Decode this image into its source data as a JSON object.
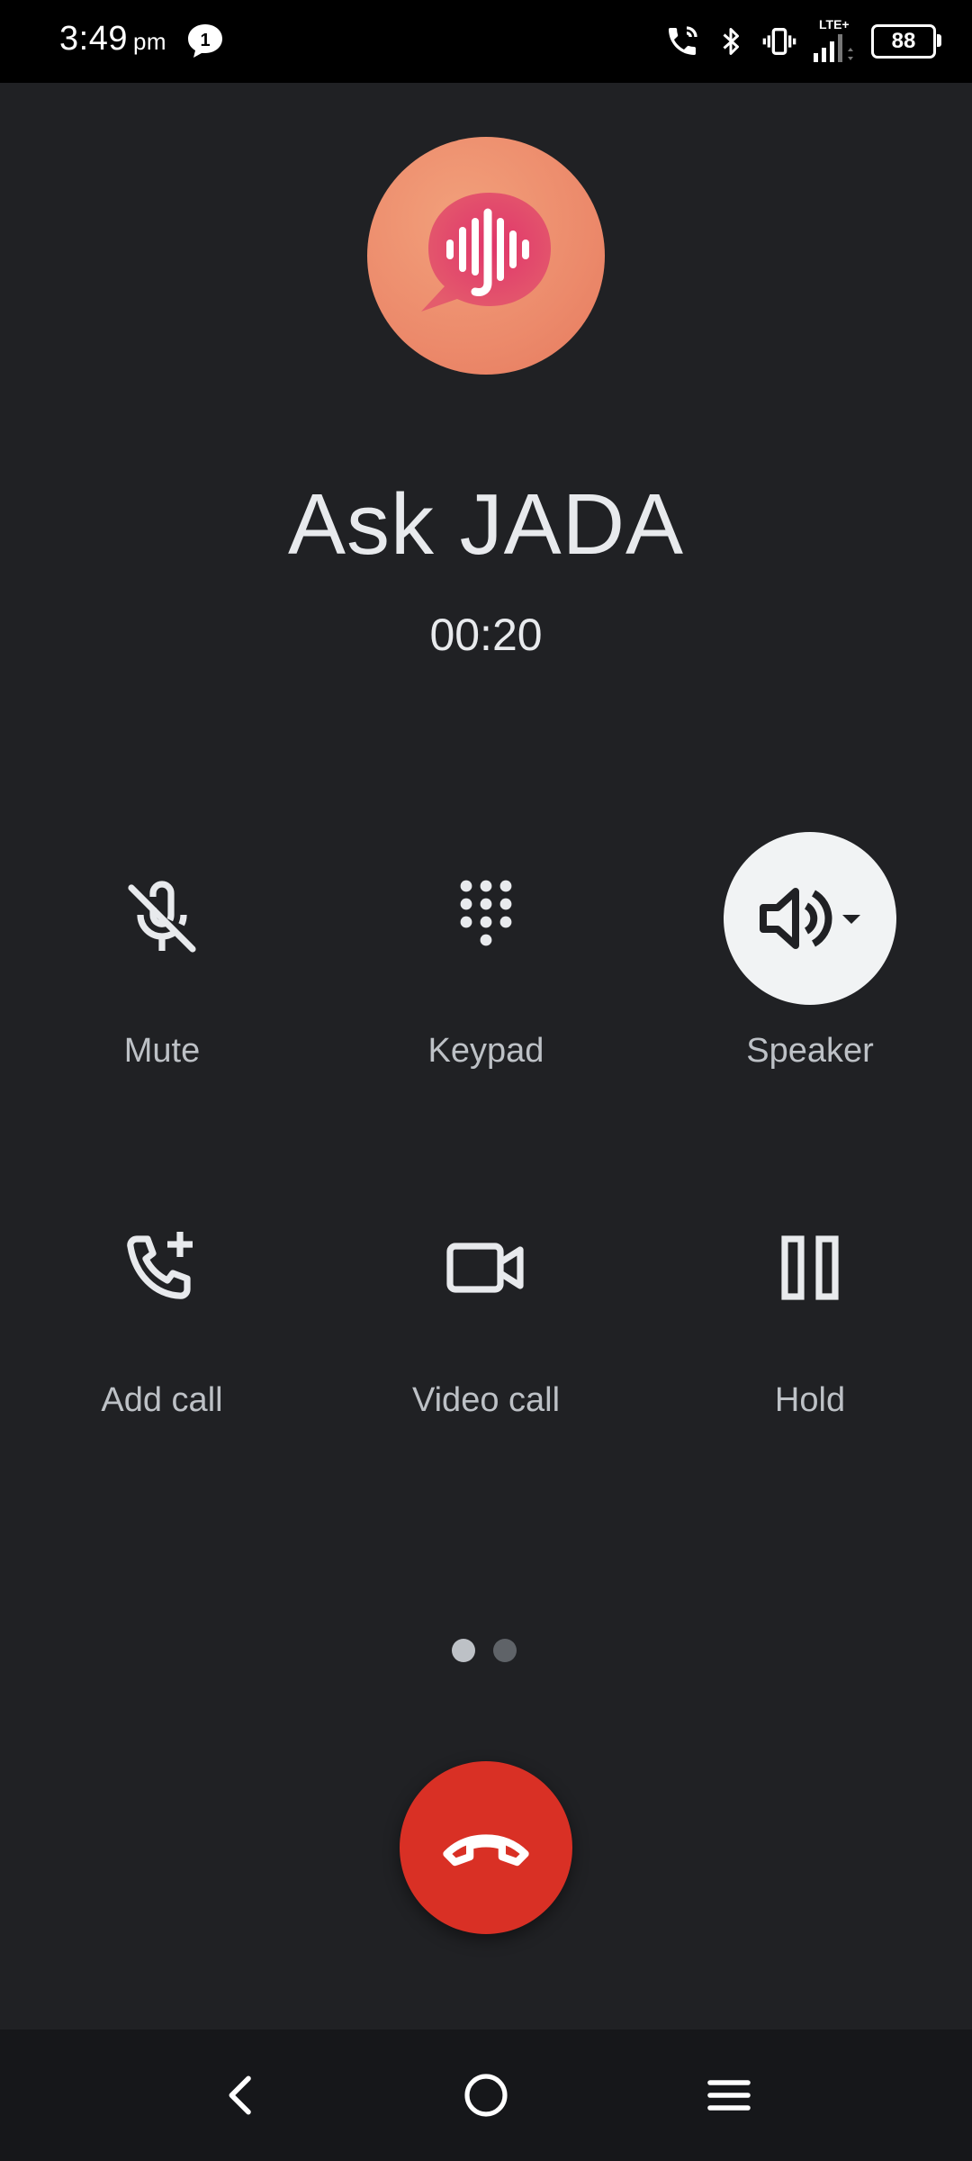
{
  "status_bar": {
    "time": "3:49",
    "ampm": "pm",
    "notification_count": "1",
    "network_type": "LTE+",
    "battery_level": "88",
    "icons": [
      "message-notification-icon",
      "call-active-icon",
      "bluetooth-icon",
      "vibrate-icon",
      "signal-icon",
      "battery-icon"
    ]
  },
  "caller": {
    "name": "Ask JADA",
    "duration": "00:20",
    "avatar_icon": "voice-assistant-logo-icon"
  },
  "controls": [
    {
      "label": "Mute",
      "icon": "mic-off-icon",
      "active": false
    },
    {
      "label": "Keypad",
      "icon": "dialpad-icon",
      "active": false
    },
    {
      "label": "Speaker",
      "icon": "speaker-icon",
      "active": true
    },
    {
      "label": "Add call",
      "icon": "add-call-icon",
      "active": false
    },
    {
      "label": "Video call",
      "icon": "video-camera-icon",
      "active": false
    },
    {
      "label": "Hold",
      "icon": "pause-icon",
      "active": false
    }
  ],
  "pager": {
    "pages": 2,
    "current": 1
  },
  "end_call": {
    "icon": "hang-up-icon",
    "color": "#d93025"
  },
  "navigation": {
    "icons": [
      "back-icon",
      "home-icon",
      "recents-menu-icon"
    ]
  },
  "colors": {
    "background": "#202124",
    "accent_end_call": "#d93025",
    "speaker_active_bg": "#f1f3f4",
    "avatar": "#ec8a6b"
  }
}
